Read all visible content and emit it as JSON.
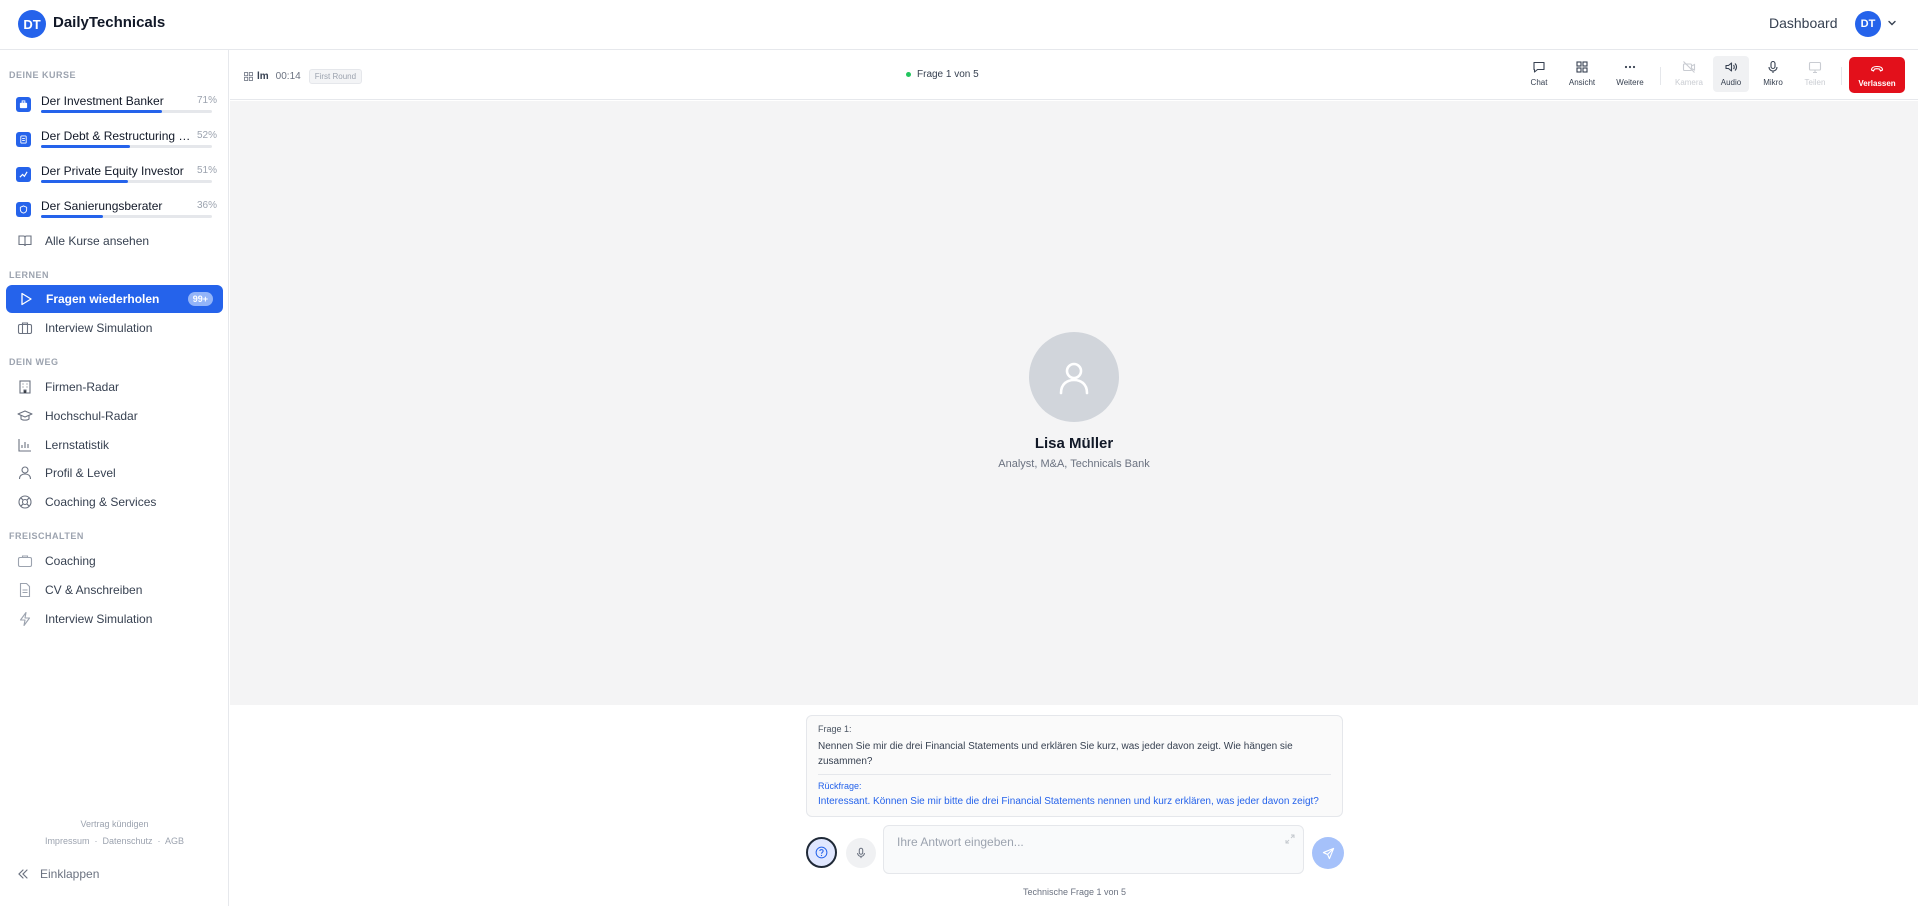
{
  "header": {
    "logo_text": "DT",
    "brand": "DailyTechnicals",
    "dashboard_link": "Dashboard",
    "avatar_initials": "DT"
  },
  "sidebar": {
    "courses_title": "DEINE KURSE",
    "courses": [
      {
        "name": "Der Investment Banker",
        "percent_label": "71%",
        "progress": 0.71
      },
      {
        "name": "Der Debt & Restructuring Experte",
        "percent_label": "52%",
        "progress": 0.52
      },
      {
        "name": "Der Private Equity Investor",
        "percent_label": "51%",
        "progress": 0.51
      },
      {
        "name": "Der Sanierungsberater",
        "percent_label": "36%",
        "progress": 0.36
      }
    ],
    "all_courses": "Alle Kurse ansehen",
    "learn_title": "LERNEN",
    "learn_items": [
      {
        "label": "Fragen wiederholen",
        "badge": "99+",
        "icon": "play-icon"
      },
      {
        "label": "Interview Simulation",
        "icon": "briefcase-icon"
      }
    ],
    "path_title": "DEIN WEG",
    "path_items": [
      {
        "label": "Firmen-Radar",
        "icon": "building-icon"
      },
      {
        "label": "Hochschul-Radar",
        "icon": "graduation-cap-icon"
      },
      {
        "label": "Lernstatistik",
        "icon": "bar-chart-icon"
      },
      {
        "label": "Profil & Level",
        "icon": "user-icon"
      },
      {
        "label": "Coaching & Services",
        "icon": "lifebuoy-icon"
      }
    ],
    "unlock_title": "FREISCHALTEN",
    "unlock_items": [
      {
        "label": "Coaching",
        "icon": "briefcase-icon"
      },
      {
        "label": "CV & Anschreiben",
        "icon": "document-icon"
      },
      {
        "label": "Interview Simulation",
        "icon": "lightning-icon"
      }
    ],
    "cancel_contract": "Vertrag kündigen",
    "footer_links": [
      "Impressum",
      "Datenschutz",
      "AGB"
    ],
    "collapse_label": "Einklappen"
  },
  "call": {
    "interviewer_short": "lm",
    "timer": "00:14",
    "round": "First Round",
    "question_progress": "Frage 1 von 5",
    "buttons": {
      "chat": "Chat",
      "view": "Ansicht",
      "more": "Weitere",
      "camera": "Kamera",
      "audio": "Audio",
      "mic": "Mikro",
      "share": "Teilen",
      "leave": "Verlassen"
    }
  },
  "participant": {
    "name": "Lisa Müller",
    "role": "Analyst, M&A, Technicals Bank"
  },
  "question": {
    "label": "Frage 1:",
    "text": "Nennen Sie mir die drei Financial Statements und erklären Sie kurz, was jeder davon zeigt. Wie hängen sie zusammen?",
    "followup_label": "Rückfrage:",
    "followup_text": "Interessant. Können Sie mir bitte die drei Financial Statements nennen und kurz erklären, was jeder davon zeigt?"
  },
  "answer": {
    "placeholder": "Ihre Antwort eingeben...",
    "value": ""
  },
  "footer": {
    "technical_question": "Technische Frage 1 von 5"
  },
  "colors": {
    "accent": "#2563eb",
    "leave": "#e3101b",
    "live_dot": "#22c55e"
  }
}
